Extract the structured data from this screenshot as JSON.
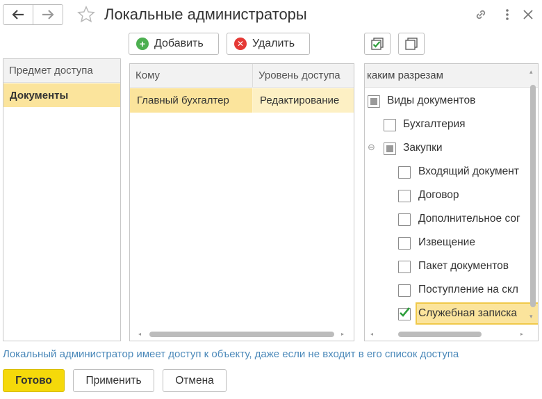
{
  "header": {
    "title": "Локальные администраторы",
    "icons": [
      "back-arrow-icon",
      "forward-arrow-icon",
      "star-icon",
      "link-icon",
      "more-vert-icon",
      "close-icon"
    ]
  },
  "toolbar": {
    "add_label": "Добавить",
    "delete_label": "Удалить",
    "colors": {
      "add": "#4caf50",
      "delete": "#e53935"
    }
  },
  "subjects": {
    "header": "Предмет доступа",
    "items": [
      "Документы"
    ]
  },
  "access": {
    "columns": [
      "Кому",
      "Уровень доступа"
    ],
    "rows": [
      {
        "who": "Главный бухгалтер",
        "level": "Редактирование"
      }
    ]
  },
  "dimensions": {
    "header": "каким разрезам",
    "tree": [
      {
        "label": "Виды документов",
        "state": "partial"
      },
      {
        "label": "Бухгалтерия",
        "state": "unchecked"
      },
      {
        "label": "Закупки",
        "state": "partial",
        "expander": "⊖"
      },
      {
        "label": "Входящий документ",
        "state": "unchecked"
      },
      {
        "label": "Договор",
        "state": "unchecked"
      },
      {
        "label": "Дополнительное сог",
        "state": "unchecked"
      },
      {
        "label": "Извещение",
        "state": "unchecked"
      },
      {
        "label": "Пакет документов",
        "state": "unchecked"
      },
      {
        "label": "Поступление на скл",
        "state": "unchecked"
      },
      {
        "label": "Служебная записка",
        "state": "checked"
      }
    ]
  },
  "footer": {
    "info": "Локальный администратор имеет доступ к объекту, даже если не входит в его список доступа",
    "ok_label": "Готово",
    "apply_label": "Применить",
    "cancel_label": "Отмена",
    "colors": {
      "ok": "#f5d90a",
      "info": "#4a88b9",
      "selection": "#fbe49c",
      "check": "#2e9e3c"
    }
  }
}
